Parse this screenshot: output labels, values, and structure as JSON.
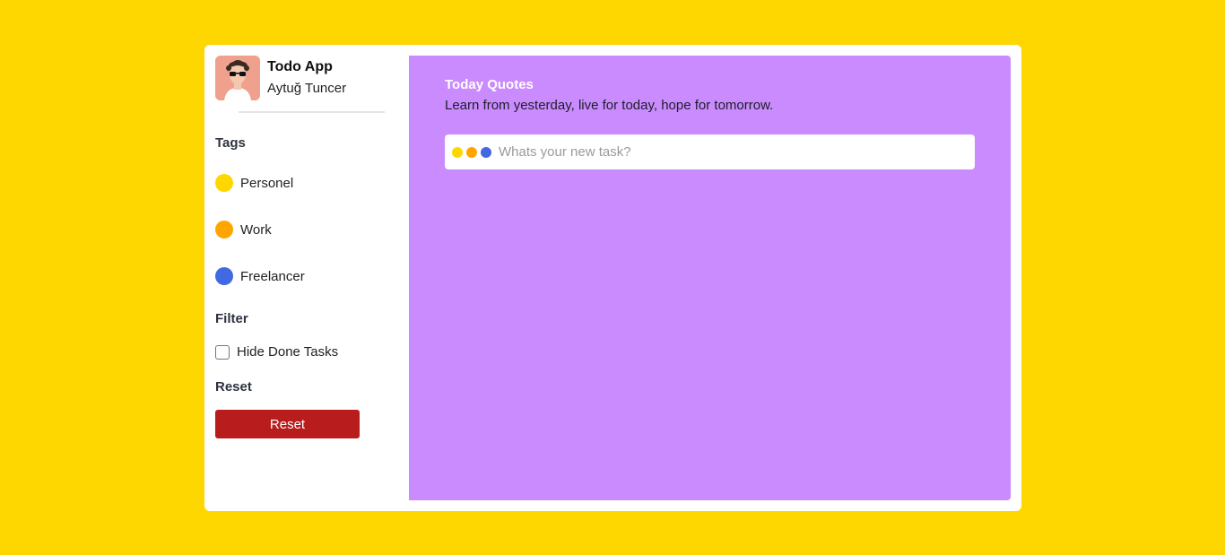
{
  "app": {
    "title": "Todo App",
    "user_name": "Aytuğ Tuncer"
  },
  "sidebar": {
    "tags_title": "Tags",
    "tags": [
      {
        "label": "Personel",
        "color": "#FFD700"
      },
      {
        "label": "Work",
        "color": "#FFA500"
      },
      {
        "label": "Freelancer",
        "color": "#4169E1"
      }
    ],
    "filter_title": "Filter",
    "hide_done_label": "Hide Done Tasks",
    "hide_done_checked": false,
    "reset_title": "Reset",
    "reset_button_label": "Reset"
  },
  "main": {
    "quotes_title": "Today Quotes",
    "quote": "Learn from yesterday, live for today, hope for tomorrow.",
    "task_input": {
      "placeholder": "Whats your new task?",
      "value": "",
      "tag_colors": [
        "#FFD700",
        "#FFA500",
        "#4169E1"
      ]
    }
  },
  "colors": {
    "page_background": "#FFD700",
    "panel_background": "#C98BFD",
    "reset_button": "#B91C1C"
  }
}
